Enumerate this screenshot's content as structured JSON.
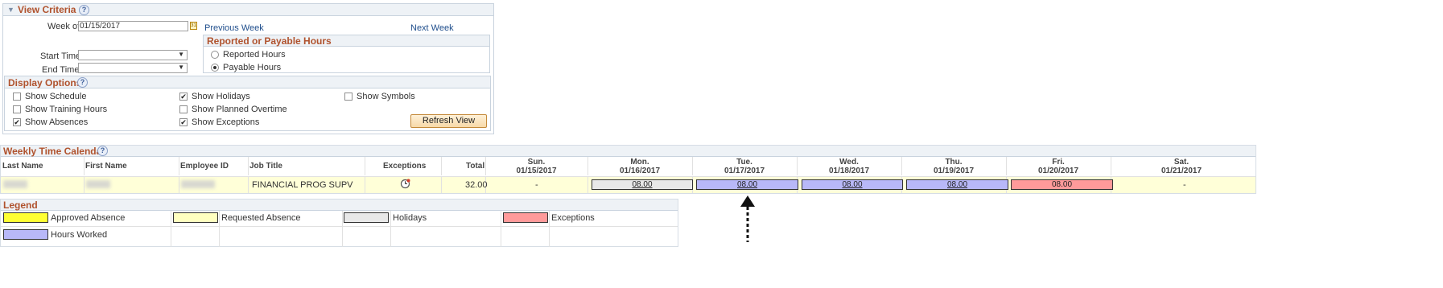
{
  "view_criteria": {
    "title": "View Criteria",
    "help": "?",
    "week_label": "Week of",
    "week_value": "01/15/2017",
    "calendar_icon_glyph": "31",
    "previous_week": "Previous Week",
    "next_week": "Next Week",
    "start_time_label": "Start Time",
    "end_time_label": "End Time",
    "start_time_value": "",
    "end_time_value": "",
    "dropdown_arrow": "▼"
  },
  "reported_payable": {
    "title": "Reported or Payable Hours",
    "options": [
      {
        "label": "Reported Hours",
        "selected": false
      },
      {
        "label": "Payable Hours",
        "selected": true
      }
    ]
  },
  "display_options": {
    "title": "Display Options",
    "help": "?",
    "options": [
      {
        "label": "Show Schedule",
        "checked": false
      },
      {
        "label": "Show Training Hours",
        "checked": false
      },
      {
        "label": "Show Absences",
        "checked": true
      },
      {
        "label": "Show Holidays",
        "checked": true
      },
      {
        "label": "Show Planned Overtime",
        "checked": false
      },
      {
        "label": "Show Exceptions",
        "checked": true
      },
      {
        "label": "Show Symbols",
        "checked": false
      }
    ],
    "check_glyph": "✔",
    "refresh_button": "Refresh View"
  },
  "weekly_calendar": {
    "title": "Weekly Time Calendar",
    "help": "?",
    "columns": {
      "last_name": "Last Name",
      "first_name": "First Name",
      "employee_id": "Employee ID",
      "job_title": "Job Title",
      "exceptions": "Exceptions",
      "total": "Total"
    },
    "days": [
      {
        "name": "Sun.",
        "date": "01/15/2017"
      },
      {
        "name": "Mon.",
        "date": "01/16/2017"
      },
      {
        "name": "Tue.",
        "date": "01/17/2017"
      },
      {
        "name": "Wed.",
        "date": "01/18/2017"
      },
      {
        "name": "Thu.",
        "date": "01/19/2017"
      },
      {
        "name": "Fri.",
        "date": "01/20/2017"
      },
      {
        "name": "Sat.",
        "date": "01/21/2017"
      }
    ],
    "row": {
      "last_name": "",
      "first_name": "",
      "employee_id": "",
      "job_title": "FINANCIAL PROG SUPV",
      "exception_icon": "clock-exception-icon",
      "total": "32.00",
      "cells": [
        {
          "value": "-",
          "kind": "none"
        },
        {
          "value": "08.00",
          "kind": "holiday"
        },
        {
          "value": "08.00",
          "kind": "worked"
        },
        {
          "value": "08.00",
          "kind": "worked"
        },
        {
          "value": "08.00",
          "kind": "worked"
        },
        {
          "value": "08.00",
          "kind": "exception"
        },
        {
          "value": "-",
          "kind": "none"
        }
      ]
    }
  },
  "legend": {
    "title": "Legend",
    "items": [
      {
        "label": "Approved Absence",
        "color": "#ffff33"
      },
      {
        "label": "Requested Absence",
        "color": "#ffffc0"
      },
      {
        "label": "Holidays",
        "color": "#e8e8e8"
      },
      {
        "label": "Exceptions",
        "color": "#ff9a9a"
      },
      {
        "label": "Hours Worked",
        "color": "#b8b8f8"
      }
    ]
  },
  "colors": {
    "holiday": "#e8e8e8",
    "worked": "#b8b8f8",
    "exception": "#ff9a9a",
    "row_highlight": "#ffffd8",
    "accent_title": "#b0522d",
    "link": "#1f4e8c"
  }
}
